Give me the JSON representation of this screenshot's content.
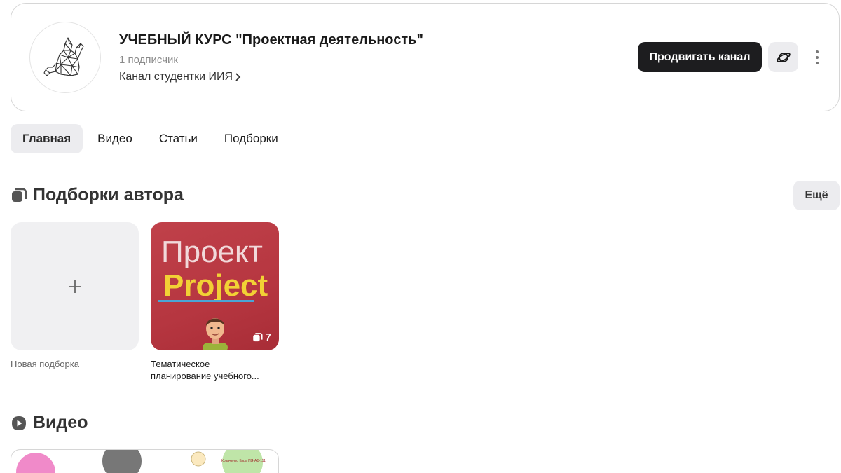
{
  "channel": {
    "title": "УЧЕБНЫЙ КУРС \"Проектная деятельность\"",
    "subscribers": "1 подписчик",
    "description": "Канал студентки ИИЯ",
    "promote_label": "Продвигать канал",
    "avatar_icon": "cat-logo-icon"
  },
  "tabs": [
    {
      "label": "Главная",
      "active": true
    },
    {
      "label": "Видео",
      "active": false
    },
    {
      "label": "Статьи",
      "active": false
    },
    {
      "label": "Подборки",
      "active": false
    }
  ],
  "collections": {
    "title": "Подборки автора",
    "more_label": "Ещё",
    "new_label": "Новая подборка",
    "items": [
      {
        "cover_ru": "Проект",
        "cover_en": "Project",
        "count": "7",
        "caption_line1": "Тематическое",
        "caption_line2": "планирование учебного..."
      }
    ]
  },
  "videos": {
    "title": "Видео",
    "thumb_text": "Кравченко Кира ИЯ-АБ-111"
  },
  "colors": {
    "accent_dark": "#1d1d1f",
    "pill_bg": "#ececef",
    "cover_red": "#b63640",
    "cover_yellow": "#f2d135"
  }
}
